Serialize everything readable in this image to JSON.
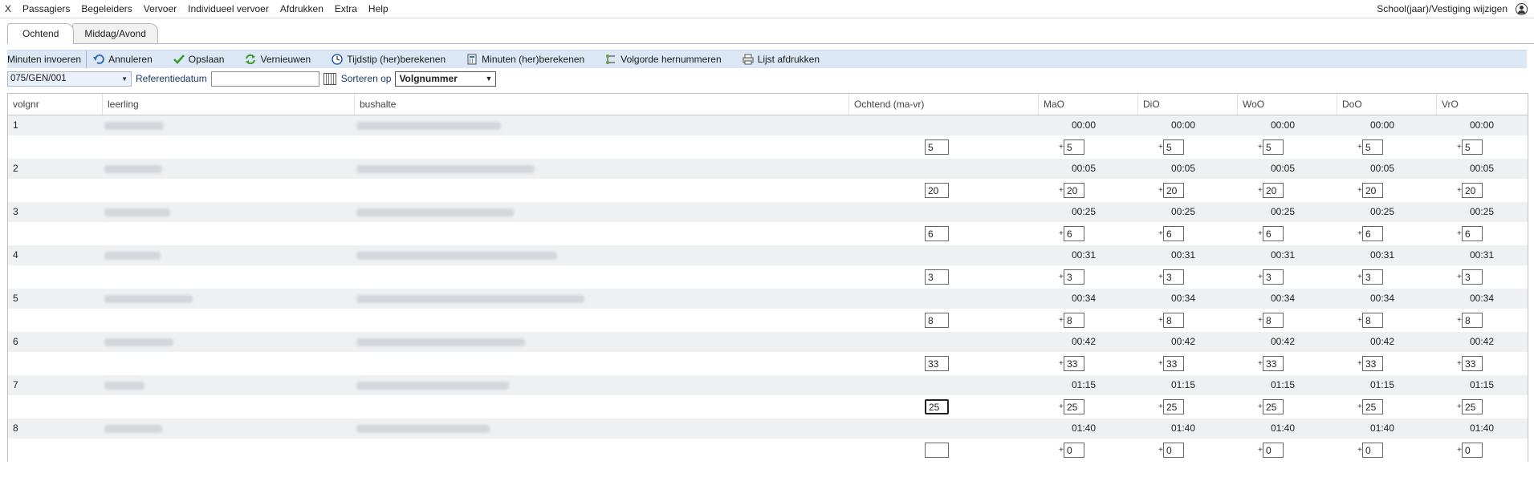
{
  "menu": {
    "items": [
      "X",
      "Passagiers",
      "Begeleiders",
      "Vervoer",
      "Individueel vervoer",
      "Afdrukken",
      "Extra",
      "Help"
    ],
    "right_label": "School(jaar)/Vestiging wijzigen",
    "user_icon": "user-circle-icon"
  },
  "tabs": {
    "morning": "Ochtend",
    "afternoon": "Middag/Avond",
    "active": "Ochtend"
  },
  "toolbar": {
    "mode_label": "Minuten invoeren",
    "cancel": "Annuleren",
    "save": "Opslaan",
    "refresh": "Vernieuwen",
    "recalc_time": "Tijdstip (her)berekenen",
    "recalc_minutes": "Minuten (her)berekenen",
    "renumber": "Volgorde hernummeren",
    "print": "Lijst afdrukken"
  },
  "filter": {
    "route_value": "075/GEN/001",
    "ref_date_label": "Referentiedatum",
    "ref_date_value": "",
    "sort_label": "Sorteren op",
    "sort_value": "Volgnummer"
  },
  "grid": {
    "headers": {
      "volgnr": "volgnr",
      "leerling": "leerling",
      "bushalte": "bushalte",
      "ochtend": "Ochtend (ma-vr)",
      "mao": "MaO",
      "dio": "DiO",
      "woo": "WoO",
      "doo": "DoO",
      "vro": "VrO"
    },
    "rows": [
      {
        "volgnr": "1",
        "time": "00:00",
        "minutes": "5",
        "day_minutes": "5"
      },
      {
        "volgnr": "2",
        "time": "00:05",
        "minutes": "20",
        "day_minutes": "20"
      },
      {
        "volgnr": "3",
        "time": "00:25",
        "minutes": "6",
        "day_minutes": "6"
      },
      {
        "volgnr": "4",
        "time": "00:31",
        "minutes": "3",
        "day_minutes": "3"
      },
      {
        "volgnr": "5",
        "time": "00:34",
        "minutes": "8",
        "day_minutes": "8"
      },
      {
        "volgnr": "6",
        "time": "00:42",
        "minutes": "33",
        "day_minutes": "33"
      },
      {
        "volgnr": "7",
        "time": "01:15",
        "minutes": "25",
        "day_minutes": "25"
      },
      {
        "volgnr": "8",
        "time": "01:40",
        "minutes": "",
        "day_minutes": "0"
      }
    ],
    "plus_sign": "+"
  }
}
